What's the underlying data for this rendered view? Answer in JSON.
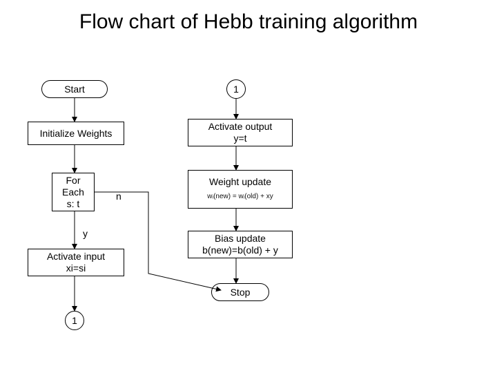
{
  "title": "Flow chart of Hebb training algorithm",
  "nodes": {
    "start": "Start",
    "conn_right_top": "1",
    "init": "Initialize Weights",
    "activate_out": "Activate output\ny=t",
    "loop": "For\nEach\ns: t",
    "weight_update_title": "Weight update",
    "weight_update_formula": "wᵢ(new) = wᵢ(old) + xy",
    "bias_update": "Bias update\nb(new)=b(old) + y",
    "activate_in": "Activate input\nxi=si",
    "stop": "Stop",
    "conn_left_bot": "1"
  },
  "edge_labels": {
    "n": "n",
    "y": "y"
  }
}
